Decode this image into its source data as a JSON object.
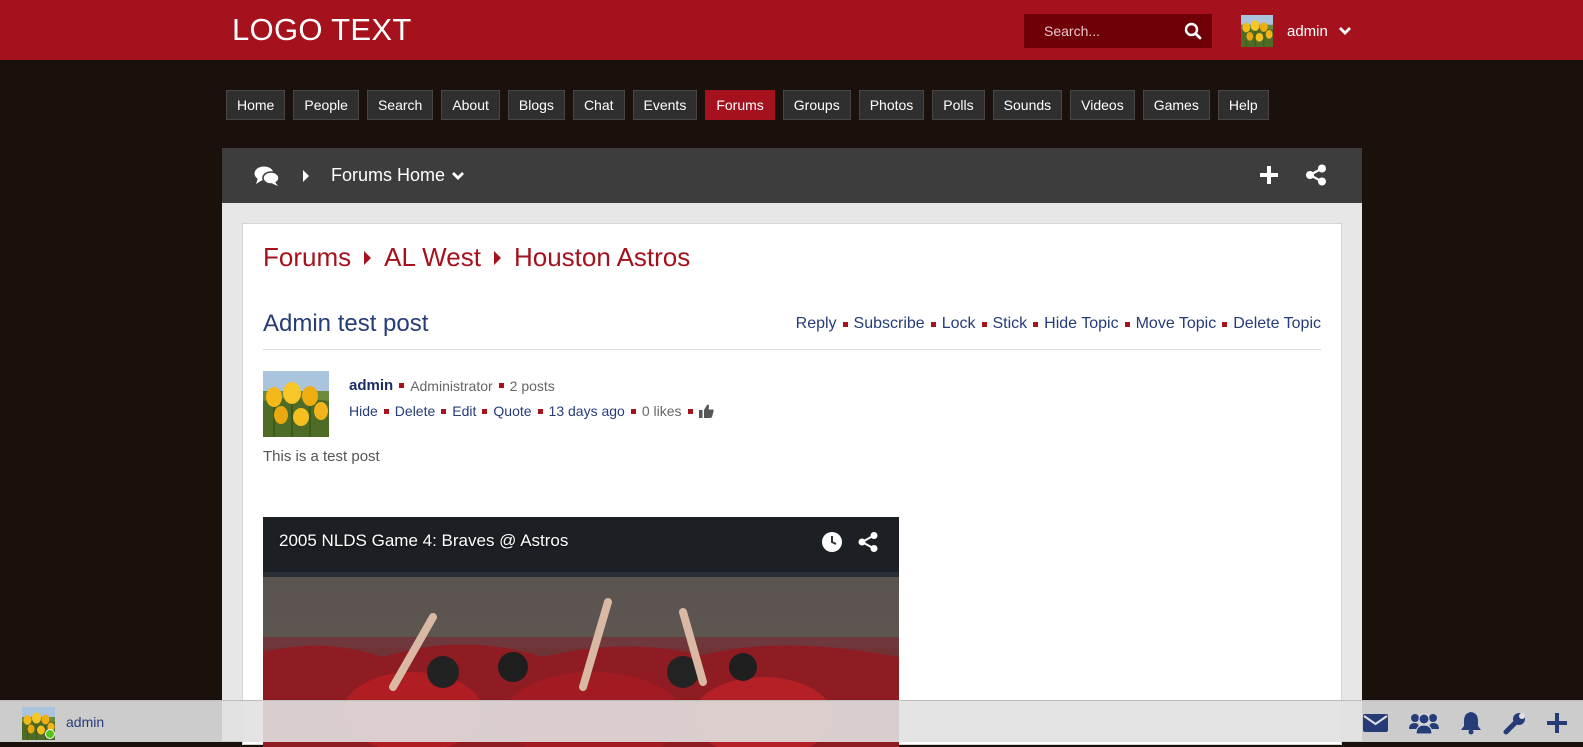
{
  "header": {
    "logo": "LOGO TEXT",
    "search_placeholder": "Search...",
    "user_name": "admin"
  },
  "nav": {
    "items": [
      "Home",
      "People",
      "Search",
      "About",
      "Blogs",
      "Chat",
      "Events",
      "Forums",
      "Groups",
      "Photos",
      "Polls",
      "Sounds",
      "Videos",
      "Games",
      "Help"
    ],
    "active": "Forums"
  },
  "forum_bar": {
    "title": "Forums Home"
  },
  "breadcrumb": [
    "Forums",
    "AL West",
    "Houston Astros"
  ],
  "topic": {
    "title": "Admin test post",
    "actions": [
      "Reply",
      "Subscribe",
      "Lock",
      "Stick",
      "Hide Topic",
      "Move Topic",
      "Delete Topic"
    ]
  },
  "post": {
    "author": "admin",
    "role": "Administrator",
    "post_count": "2 posts",
    "actions": [
      "Hide",
      "Delete",
      "Edit",
      "Quote"
    ],
    "time": "13 days ago",
    "likes": "0 likes",
    "body": "This is a test post",
    "video_title": "2005 NLDS Game 4: Braves @ Astros"
  },
  "bottom_bar": {
    "user_name": "admin",
    "icons": [
      "envelope-icon",
      "users-icon",
      "bell-icon",
      "wrench-icon",
      "plus-icon"
    ]
  },
  "colors": {
    "brand_red": "#a5121d",
    "search_bg": "#700008",
    "link_blue": "#253c78",
    "page_bg": "#1a110d",
    "forum_bar_bg": "#3d3d3d"
  }
}
